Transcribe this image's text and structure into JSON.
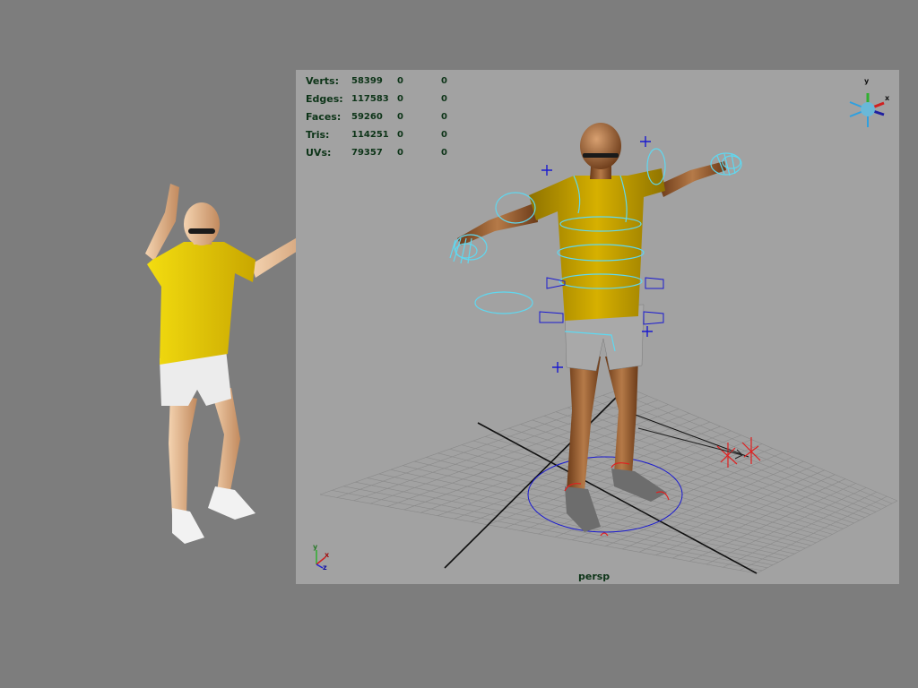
{
  "viewport": {
    "camera": "persp",
    "stats": [
      {
        "label": "Verts:",
        "v1": "58399",
        "v2": "0",
        "v3": "0"
      },
      {
        "label": "Edges:",
        "v1": "117583",
        "v2": "0",
        "v3": "0"
      },
      {
        "label": "Faces:",
        "v1": "59260",
        "v2": "0",
        "v3": "0"
      },
      {
        "label": "Tris:",
        "v1": "114251",
        "v2": "0",
        "v3": "0"
      },
      {
        "label": "UVs:",
        "v1": "79357",
        "v2": "0",
        "v3": "0"
      }
    ],
    "view_cube": {
      "x": "x",
      "y": "y",
      "z": "z"
    },
    "origin_axis": {
      "x": "x",
      "y": "y",
      "z": "z"
    }
  },
  "colors": {
    "page_background": "#7d7d7d",
    "viewport_background": "#a2a2a2",
    "hud_text": "#0d3418",
    "shirt": "#c9a400",
    "shorts": "#bcbcbc",
    "skin": "#a0652f",
    "controls_cyan": "#5fd8f0",
    "controls_blue": "#1a1ad0",
    "controls_red": "#e02020"
  }
}
